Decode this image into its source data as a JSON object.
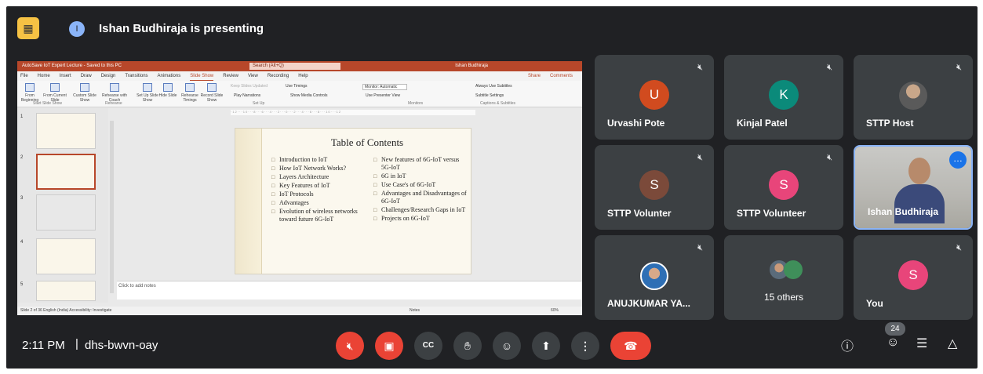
{
  "header": {
    "presenter_initial": "I",
    "presenting_text": "Ishan Budhiraja is presenting"
  },
  "ppt": {
    "title_bar": "AutoSave  IoT Expert Lecture - Saved to this PC",
    "search": "Search (Alt+Q)",
    "user": "Ishan Budhiraja",
    "tabs": [
      "File",
      "Home",
      "Insert",
      "Draw",
      "Design",
      "Transitions",
      "Animations",
      "Slide Show",
      "Review",
      "View",
      "Recording",
      "Help"
    ],
    "share": "Share",
    "comments": "Comments",
    "ribbon": {
      "from_beginning": "From Beginning",
      "from_current": "From Current Slide",
      "custom": "Custom Slide Show",
      "rehearse_coach": "Rehearse with Coach",
      "setup": "Set Up Slide Show",
      "hide": "Hide Slide",
      "rehearse_timings": "Rehearse Timings",
      "record": "Record Slide Show",
      "keep_updated": "Keep Slides Updated",
      "use_timings": "Use Timings",
      "play_narrations": "Play Narrations",
      "show_media": "Show Media Controls",
      "monitor": "Monitor: Automatic",
      "presenter_view": "Use Presenter View",
      "always_subtitles": "Always Use Subtitles",
      "subtitle_settings": "Subtitle Settings",
      "grp_start": "Start Slide Show",
      "grp_rehearse": "Rehearse",
      "grp_setup": "Set Up",
      "grp_monitors": "Monitors",
      "grp_captions": "Captions & Subtitles"
    },
    "thumb_numbers": [
      "1",
      "2",
      "3",
      "4",
      "5"
    ],
    "slide": {
      "title": "Table of Contents",
      "left": [
        "Introduction to IoT",
        "How IoT Network Works?",
        "Layers Architecture",
        "Key Features of IoT",
        "IoT Protocols",
        "Advantages",
        "Evolution of wireless networks toward future 6G-IoT"
      ],
      "right": [
        "New features of 6G-IoT versus 5G-IoT",
        "6G in IoT",
        "Use Case's of 6G-IoT",
        "Advantages and Disadvantages of 6G-IoT",
        "Challenges/Research Gaps in IoT",
        "Projects on 6G-IoT"
      ]
    },
    "notes_placeholder": "Click to add notes",
    "status": "Slide 2 of 36    English (India)    Accessibility: Investigate",
    "status_right": "Notes",
    "zoom": "60%"
  },
  "participants": [
    {
      "name": "Urvashi Pote",
      "initial": "U",
      "color": "#d14b1f"
    },
    {
      "name": "Kinjal Patel",
      "initial": "K",
      "color": "#0b8a7a"
    },
    {
      "name": "STTP Host",
      "initial": "",
      "color": "#5f6368"
    },
    {
      "name": "STTP Volunter",
      "initial": "S",
      "color": "#7b4a3a"
    },
    {
      "name": "STTP Volunteer",
      "initial": "S",
      "color": "#e8457a"
    },
    {
      "name": "Ishan Budhiraja",
      "initial": "",
      "color": "#1a73e8"
    },
    {
      "name": "ANUJKUMAR YA...",
      "initial": "",
      "color": "#ffffff"
    },
    {
      "name": "15 others",
      "initial": "",
      "color": "#3c4043"
    },
    {
      "name": "You",
      "initial": "S",
      "color": "#e8457a"
    }
  ],
  "footer": {
    "time": "2:11 PM",
    "separator": "|",
    "meeting_code": "dhs-bwvn-oay",
    "participant_count": "24"
  }
}
